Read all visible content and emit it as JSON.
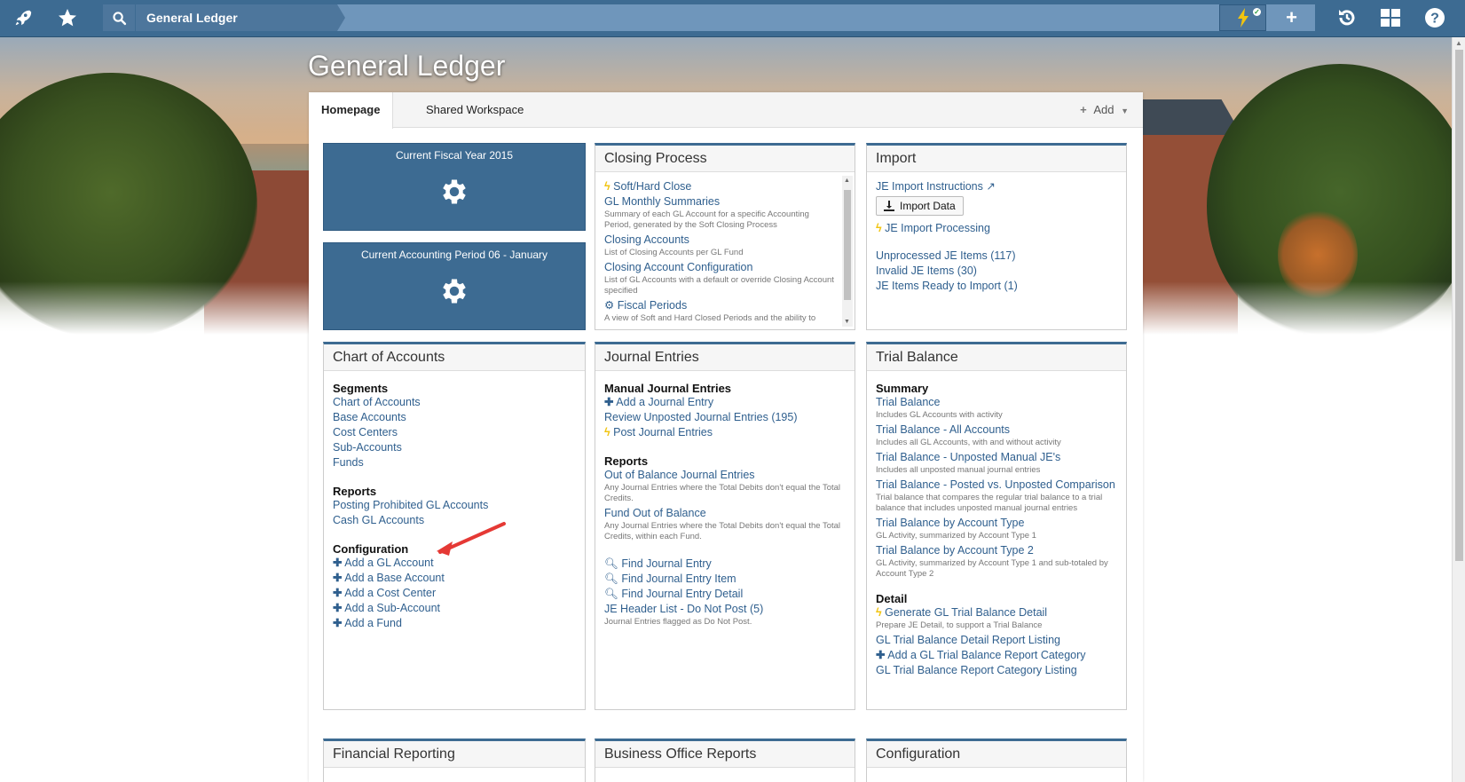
{
  "topbar": {
    "icons": [
      "rocket-icon",
      "star-icon",
      "search-icon",
      "lightning-icon",
      "plus-icon",
      "history-icon",
      "grid-icon",
      "help-icon"
    ],
    "breadcrumb": "General Ledger",
    "accent_color": "#3d6b92"
  },
  "page": {
    "title": "General Ledger"
  },
  "tabs": {
    "homepage": "Homepage",
    "shared_workspace": "Shared Workspace",
    "add": "Add"
  },
  "tiles": [
    {
      "label": "Current Fiscal Year 2015"
    },
    {
      "label": "Current Accounting Period 06 - January"
    }
  ],
  "closing_process": {
    "title": "Closing Process",
    "items": [
      {
        "label": "Soft/Hard Close",
        "desc": ""
      },
      {
        "label": "GL Monthly Summaries",
        "desc": "Summary of each GL Account for a specific Accounting Period, generated by the Soft Closing Process"
      },
      {
        "label": "Closing Accounts",
        "desc": "List of Closing Accounts per GL Fund"
      },
      {
        "label": "Closing Account Configuration",
        "desc": "List of GL Accounts with a default or override Closing Account specified"
      },
      {
        "label": "Fiscal Periods",
        "desc": "A view of Soft and Hard Closed Periods and the ability to"
      }
    ]
  },
  "import": {
    "title": "Import",
    "instructions": "JE Import Instructions",
    "import_button": "Import Data",
    "processing": "JE Import Processing",
    "unprocessed": "Unprocessed JE Items",
    "unprocessed_count": "(117)",
    "invalid": "Invalid JE Items",
    "invalid_count": "(30)",
    "ready": "JE Items Ready to Import",
    "ready_count": "(1)"
  },
  "chart_of_accounts": {
    "title": "Chart of Accounts",
    "segments_heading": "Segments",
    "segments": [
      "Chart of Accounts",
      "Base Accounts",
      "Cost Centers",
      "Sub-Accounts",
      "Funds"
    ],
    "reports_heading": "Reports",
    "reports": [
      "Posting Prohibited GL Accounts",
      "Cash GL Accounts"
    ],
    "config_heading": "Configuration",
    "config": [
      "Add a GL Account",
      "Add a Base Account",
      "Add a Cost Center",
      "Add a Sub-Account",
      "Add a Fund"
    ]
  },
  "journal_entries": {
    "title": "Journal Entries",
    "manual_heading": "Manual Journal Entries",
    "add_je": "Add a Journal Entry",
    "review_unposted": "Review Unposted Journal Entries",
    "review_count": "(195)",
    "post": "Post Journal Entries",
    "reports_heading": "Reports",
    "out_of_balance": "Out of Balance Journal Entries",
    "out_of_balance_desc": "Any Journal Entries where the Total Debits don't equal the Total Credits.",
    "fund_out_of_balance": "Fund Out of Balance",
    "fund_out_of_balance_desc": "Any Journal Entries where the Total Debits don't equal the Total Credits, within each Fund.",
    "find_je": "Find Journal Entry",
    "find_je_item": "Find Journal Entry Item",
    "find_je_detail": "Find Journal Entry Detail",
    "header_list": "JE Header List - Do Not Post",
    "header_list_count": "(5)",
    "header_list_desc": "Journal Entries flagged as Do Not Post."
  },
  "trial_balance": {
    "title": "Trial Balance",
    "summary_heading": "Summary",
    "summary": [
      {
        "label": "Trial Balance",
        "desc": "Includes GL Accounts with activity"
      },
      {
        "label": "Trial Balance - All Accounts",
        "desc": "Includes all GL Accounts, with and without activity"
      },
      {
        "label": "Trial Balance - Unposted Manual JE's",
        "desc": "Includes all unposted manual journal entries"
      },
      {
        "label": "Trial Balance - Posted vs. Unposted Comparison",
        "desc": "Trial balance that compares the regular trial balance to a trial balance that includes unposted manual journal entries"
      },
      {
        "label": "Trial Balance by Account Type",
        "desc": "GL Activity, summarized by Account Type 1"
      },
      {
        "label": "Trial Balance by Account Type 2",
        "desc": "GL Activity, summarized by Account Type 1 and sub-totaled by Account Type 2"
      }
    ],
    "detail_heading": "Detail",
    "generate": "Generate GL Trial Balance Detail",
    "generate_desc": "Prepare JE Detail, to support a Trial Balance",
    "detail_listing": "GL Trial Balance Detail Report Listing",
    "add_category": "Add a GL Trial Balance Report Category",
    "category_listing": "GL Trial Balance Report Category Listing"
  },
  "bottom_widgets": {
    "financial_reporting": "Financial Reporting",
    "business_office": "Business Office Reports",
    "configuration": "Configuration"
  }
}
